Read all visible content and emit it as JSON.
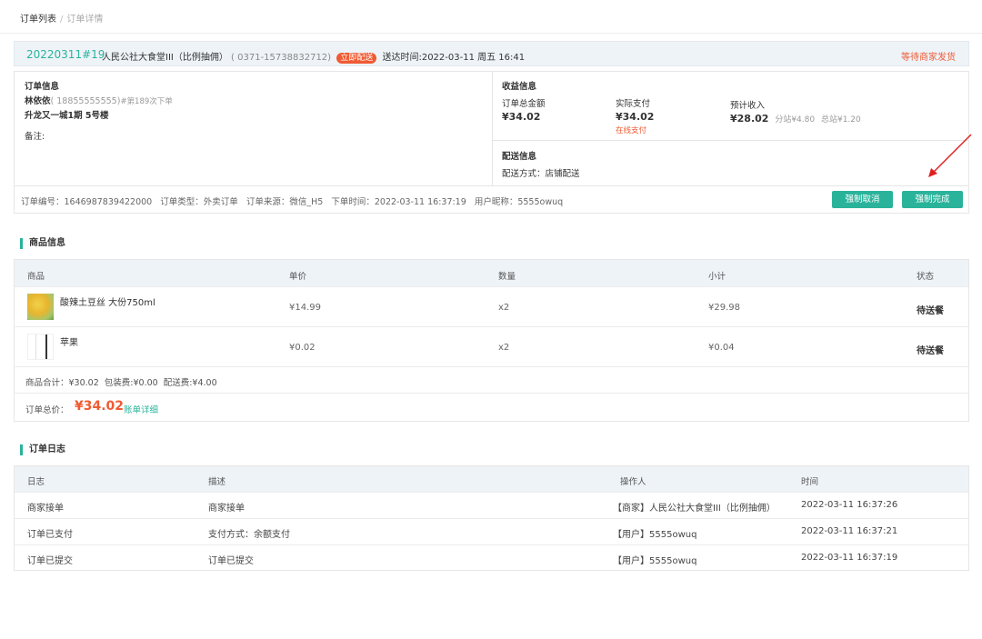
{
  "breadcrumb": {
    "parent": "订单列表",
    "separator": "/",
    "current": "订单详情"
  },
  "header": {
    "order_no": "20220311#19",
    "shop": "人民公社大食堂III（比例抽佣）",
    "phone": "( 0371-15738832712)",
    "badge": "立即配送",
    "delivery_time": "送达时间:2022-03-11 周五 16:41",
    "status": "等待商家发货"
  },
  "order_info": {
    "title": "订单信息",
    "customer_name": "林依依",
    "customer_phone": "( 18855555555)",
    "order_count": "#第189次下单",
    "address": "升龙又一城1期 5号楼",
    "remark_label": "备注:"
  },
  "income": {
    "title": "收益信息",
    "total_label": "订单总金额",
    "total_value": "¥34.02",
    "paid_label": "实际支付",
    "paid_value": "¥34.02",
    "paid_note": "在线支付",
    "expected_label": "预计收入",
    "expected_value": "¥28.02",
    "branch_fee": "分站¥4.80",
    "hq_fee": "总站¥1.20"
  },
  "delivery": {
    "title": "配送信息",
    "method": "配送方式：店铺配送"
  },
  "meta": {
    "order_id": "订单编号：1646987839422000",
    "order_type": "订单类型：外卖订单",
    "order_source": "订单来源：微信_H5",
    "order_time": "下单时间：2022-03-11 16:37:19",
    "user_nick": "用户昵称：5555owuq",
    "cancel_btn": "强制取消",
    "complete_btn": "强制完成"
  },
  "goods": {
    "section_title": "商品信息",
    "columns": [
      "商品",
      "单价",
      "数量",
      "小计",
      "状态"
    ],
    "rows": [
      {
        "name": "酸辣土豆丝 大份750ml",
        "price": "¥14.99",
        "qty": "x2",
        "subtotal": "¥29.98",
        "status": "待送餐"
      },
      {
        "name": "苹果",
        "price": "¥0.02",
        "qty": "x2",
        "subtotal": "¥0.04",
        "status": "待送餐"
      }
    ],
    "summary": "商品合计：¥30.02  包装费:¥0.00  配送费:¥4.00",
    "total_label": "订单总价：",
    "total_value": "¥34.02",
    "bill_link": "账单详细"
  },
  "log": {
    "section_title": "订单日志",
    "columns": [
      "日志",
      "描述",
      "操作人",
      "时间"
    ],
    "rows": [
      {
        "log": "商家接单",
        "desc": "商家接单",
        "operator": "【商家】人民公社大食堂III（比例抽佣）",
        "time": "2022-03-11 16:37:26"
      },
      {
        "log": "订单已支付",
        "desc": "支付方式：余额支付",
        "operator": "【用户】5555owuq",
        "time": "2022-03-11 16:37:21"
      },
      {
        "log": "订单已提交",
        "desc": "订单已提交",
        "operator": "【用户】5555owuq",
        "time": "2022-03-11 16:37:19"
      }
    ]
  },
  "colors": {
    "accent": "#2ab39b",
    "warning": "#ef5b33",
    "header_bg": "#eef3f8"
  }
}
